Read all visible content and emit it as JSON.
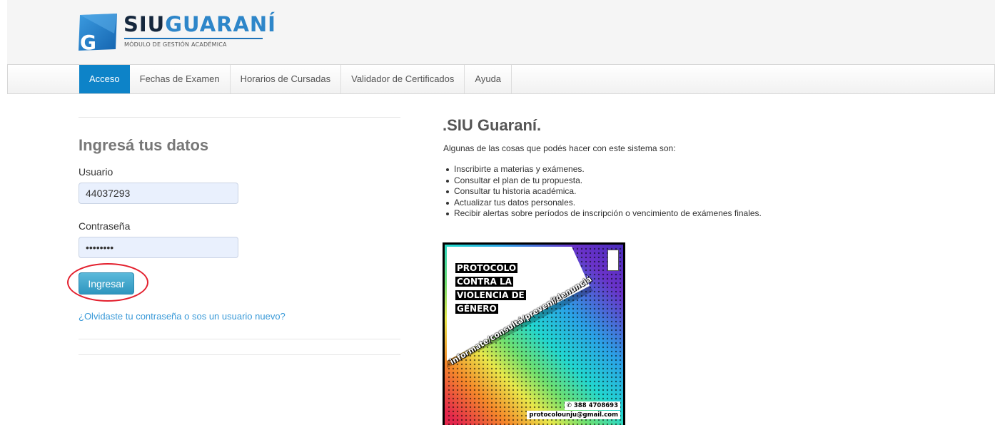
{
  "brand": {
    "siu": "SIU",
    "guarani": "GUARANÍ",
    "subtitle": "MÓDULO DE GESTIÓN ACADÉMICA",
    "primary_color": "#0d83c8"
  },
  "nav": {
    "items": [
      {
        "label": "Acceso",
        "active": true
      },
      {
        "label": "Fechas de Examen"
      },
      {
        "label": "Horarios de Cursadas"
      },
      {
        "label": "Validador de Certificados"
      },
      {
        "label": "Ayuda"
      }
    ]
  },
  "login": {
    "title": "Ingresá tus datos",
    "user_label": "Usuario",
    "user_value": "44037293",
    "password_label": "Contraseña",
    "password_value": "••••••••",
    "submit_label": "Ingresar",
    "forgot_link": "¿Olvidaste tu contraseña o sos un usuario nuevo?"
  },
  "info": {
    "title": ".SIU Guaraní.",
    "intro": "Algunas de las cosas que podés hacer con este sistema son:",
    "items": [
      "Inscribirte a materias y exámenes.",
      "Consultar el plan de tu propuesta.",
      "Consultar tu historia académica.",
      "Actualizar tus datos personales.",
      "Recibir alertas sobre períodos de inscripción o vencimiento de exámenes finales."
    ]
  },
  "poster": {
    "title_lines": [
      "PROTOCOLO",
      "CONTRA LA",
      "VIOLENCIA DE",
      "GÉNERO"
    ],
    "slogan": "informate/consultá/prevení/denunciá",
    "phone": "388 4708693",
    "email": "protocolounju@gmail.com"
  }
}
